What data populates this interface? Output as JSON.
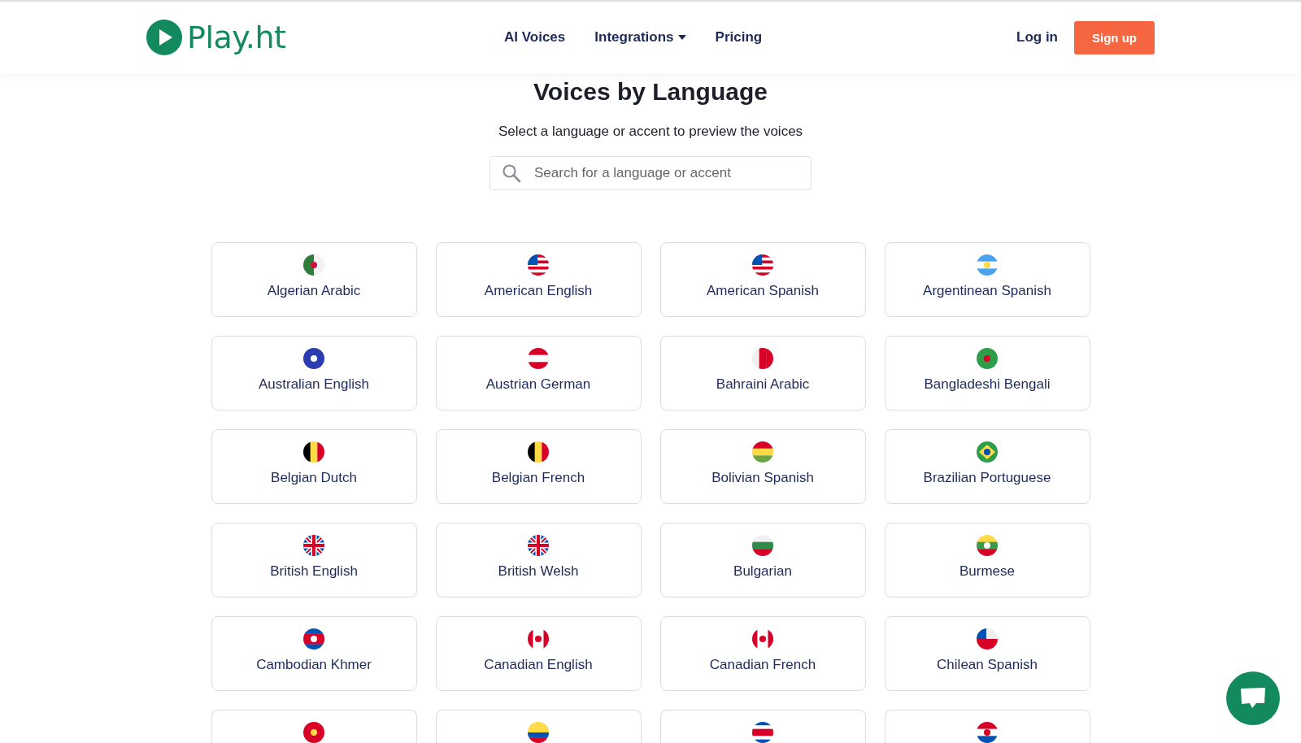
{
  "header": {
    "logo": "Play.ht",
    "nav": [
      {
        "label": "AI Voices",
        "kind": "link"
      },
      {
        "label": "Integrations",
        "kind": "dropdown"
      },
      {
        "label": "Pricing",
        "kind": "link"
      }
    ],
    "login": "Log in",
    "signup": "Sign up"
  },
  "title": "Voices by Language",
  "subtitle": "Select a language or accent to preview the voices",
  "search": {
    "placeholder": "Search for a language or accent"
  },
  "languages": [
    {
      "kind": "card",
      "label": "Algerian Arabic"
    },
    {
      "kind": "card",
      "label": "American English"
    },
    {
      "kind": "card",
      "label": "American Spanish"
    },
    {
      "kind": "card",
      "label": "Argentinean Spanish"
    },
    {
      "kind": "card",
      "label": "Australian English"
    },
    {
      "kind": "card",
      "label": "Austrian German"
    },
    {
      "kind": "card",
      "label": "Bahraini Arabic"
    },
    {
      "kind": "card",
      "label": "Bangladeshi Bengali"
    },
    {
      "kind": "card",
      "label": "Belgian Dutch"
    },
    {
      "kind": "card",
      "label": "Belgian French"
    },
    {
      "kind": "card",
      "label": "Bolivian Spanish"
    },
    {
      "kind": "card",
      "label": "Brazilian Portuguese"
    },
    {
      "kind": "card",
      "label": "British English"
    },
    {
      "kind": "card",
      "label": "British Welsh"
    },
    {
      "kind": "card",
      "label": "Bulgarian"
    },
    {
      "kind": "card",
      "label": "Burmese"
    },
    {
      "kind": "card",
      "label": "Cambodian Khmer"
    },
    {
      "kind": "card",
      "label": "Canadian English"
    },
    {
      "kind": "card",
      "label": "Canadian French"
    },
    {
      "kind": "card",
      "label": "Chilean Spanish"
    },
    {
      "kind": "card"
    },
    {
      "kind": "card"
    },
    {
      "kind": "card"
    },
    {
      "kind": "card"
    }
  ]
}
